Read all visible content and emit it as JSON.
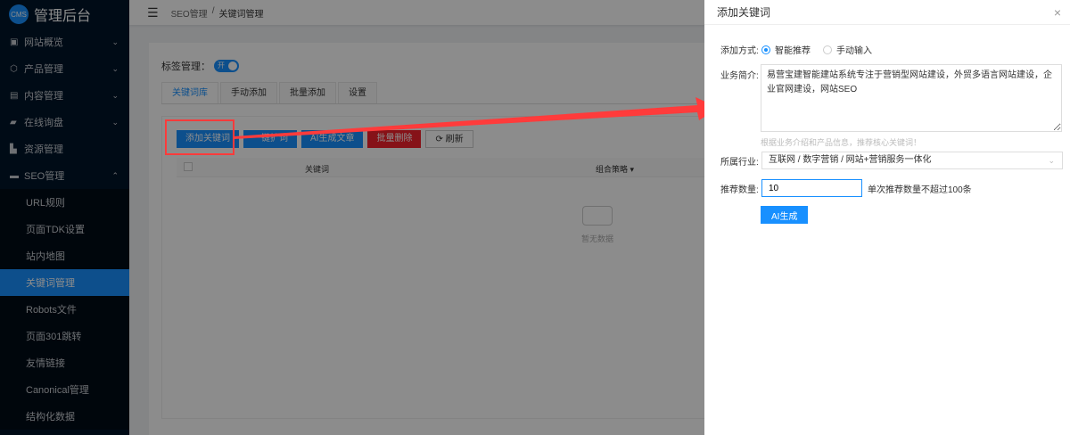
{
  "app": {
    "logo_badge": "CMS",
    "title": "管理后台"
  },
  "sidebar": {
    "items": [
      {
        "label": "网站概览",
        "icon": "monitor-icon",
        "chev": "⌄"
      },
      {
        "label": "产品管理",
        "icon": "cube-icon",
        "chev": "⌄"
      },
      {
        "label": "内容管理",
        "icon": "document-icon",
        "chev": "⌄"
      },
      {
        "label": "在线询盘",
        "icon": "chat-icon",
        "chev": "⌄"
      },
      {
        "label": "资源管理",
        "icon": "folder-icon"
      },
      {
        "label": "SEO管理",
        "icon": "seo-icon",
        "chev": "⌃"
      }
    ],
    "sub_items": [
      "URL规则",
      "页面TDK设置",
      "站内地图",
      "关键词管理",
      "Robots文件",
      "页面301跳转",
      "友情链接",
      "Canonical管理",
      "结构化数据"
    ]
  },
  "header": {
    "breadcrumb": [
      "SEO管理",
      "/",
      "关键词管理"
    ]
  },
  "main": {
    "tag_label": "标签管理：",
    "switch_label": "开",
    "tabs": [
      "关键词库",
      "手动添加",
      "批量添加",
      "设置"
    ],
    "buttons": [
      "添加关键词",
      "一键扩词",
      "AI生成文章",
      "批量删除",
      "刷新"
    ],
    "columns": [
      "关键词",
      "组合策略"
    ],
    "empty": "暂无数据"
  },
  "drawer": {
    "title": "添加关键词",
    "close": "×",
    "method_label": "添加方式:",
    "options": [
      "智能推荐",
      "手动输入"
    ],
    "intro_label": "业务简介:",
    "intro_value": "易营宝建智能建站系统专注于营销型网站建设，外贸多语言网站建设，企业官网建设，网站SEO",
    "intro_hint": "根据业务介绍和产品信息，推荐核心关键词！",
    "industry_label": "所属行业:",
    "industry_value": "互联网 / 数字营销 / 网站+营销服务一体化",
    "count_label": "推荐数量:",
    "count_value": "10",
    "count_hint": "单次推荐数量不超过100条",
    "submit": "AI生成"
  },
  "colors": {
    "accent": "#1890ff",
    "danger": "#f5222d",
    "annotation": "#ff3b3b"
  }
}
